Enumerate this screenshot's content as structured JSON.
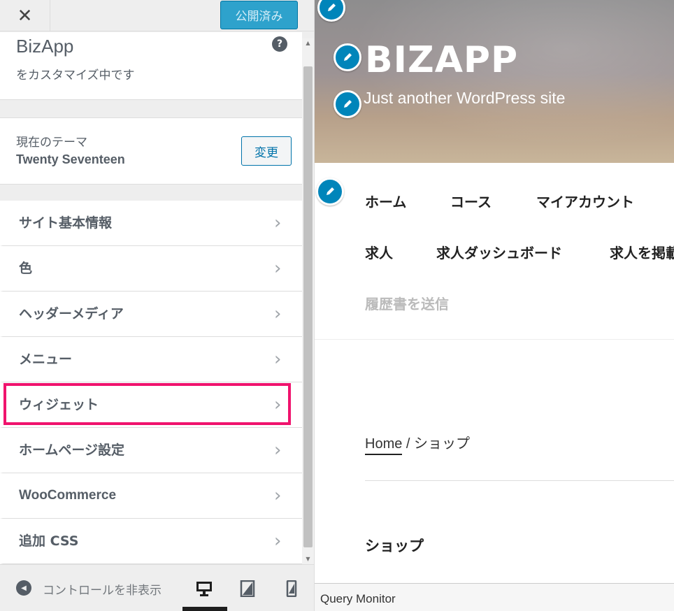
{
  "topbar": {
    "close_glyph": "✕",
    "publish_label": "公開済み"
  },
  "info": {
    "site_name": "BizApp",
    "customizing": "をカスタマイズ中です",
    "help_glyph": "?"
  },
  "theme": {
    "label": "現在のテーマ",
    "name": "Twenty Seventeen",
    "change_label": "変更"
  },
  "menu": {
    "items": [
      {
        "label": "サイト基本情報"
      },
      {
        "label": "色"
      },
      {
        "label": "ヘッダーメディア"
      },
      {
        "label": "メニュー"
      },
      {
        "label": "ウィジェット",
        "highlighted": true
      },
      {
        "label": "ホームページ設定"
      },
      {
        "label": "WooCommerce"
      },
      {
        "label": "追加 CSS"
      }
    ],
    "chevron_glyph": "›"
  },
  "footer": {
    "collapse_label": "コントロールを非表示",
    "devices": [
      "desktop-icon",
      "tablet-icon",
      "mobile-icon"
    ],
    "active_device": "desktop"
  },
  "preview": {
    "site_title": "BIZAPP",
    "tagline": "Just another WordPress site",
    "nav": [
      "ホーム",
      "コース",
      "マイアカウント",
      "求人",
      "求人ダッシュボード",
      "求人を掲載",
      "履歴書を送信"
    ],
    "breadcrumb_home": "Home",
    "breadcrumb_sep": " / ",
    "breadcrumb_current": "ショップ",
    "page_heading": "ショップ"
  },
  "query_monitor": {
    "label": "Query Monitor"
  },
  "colors": {
    "accent": "#0085ba",
    "highlight": "#f0136d",
    "publish": "#2ea2cc"
  }
}
